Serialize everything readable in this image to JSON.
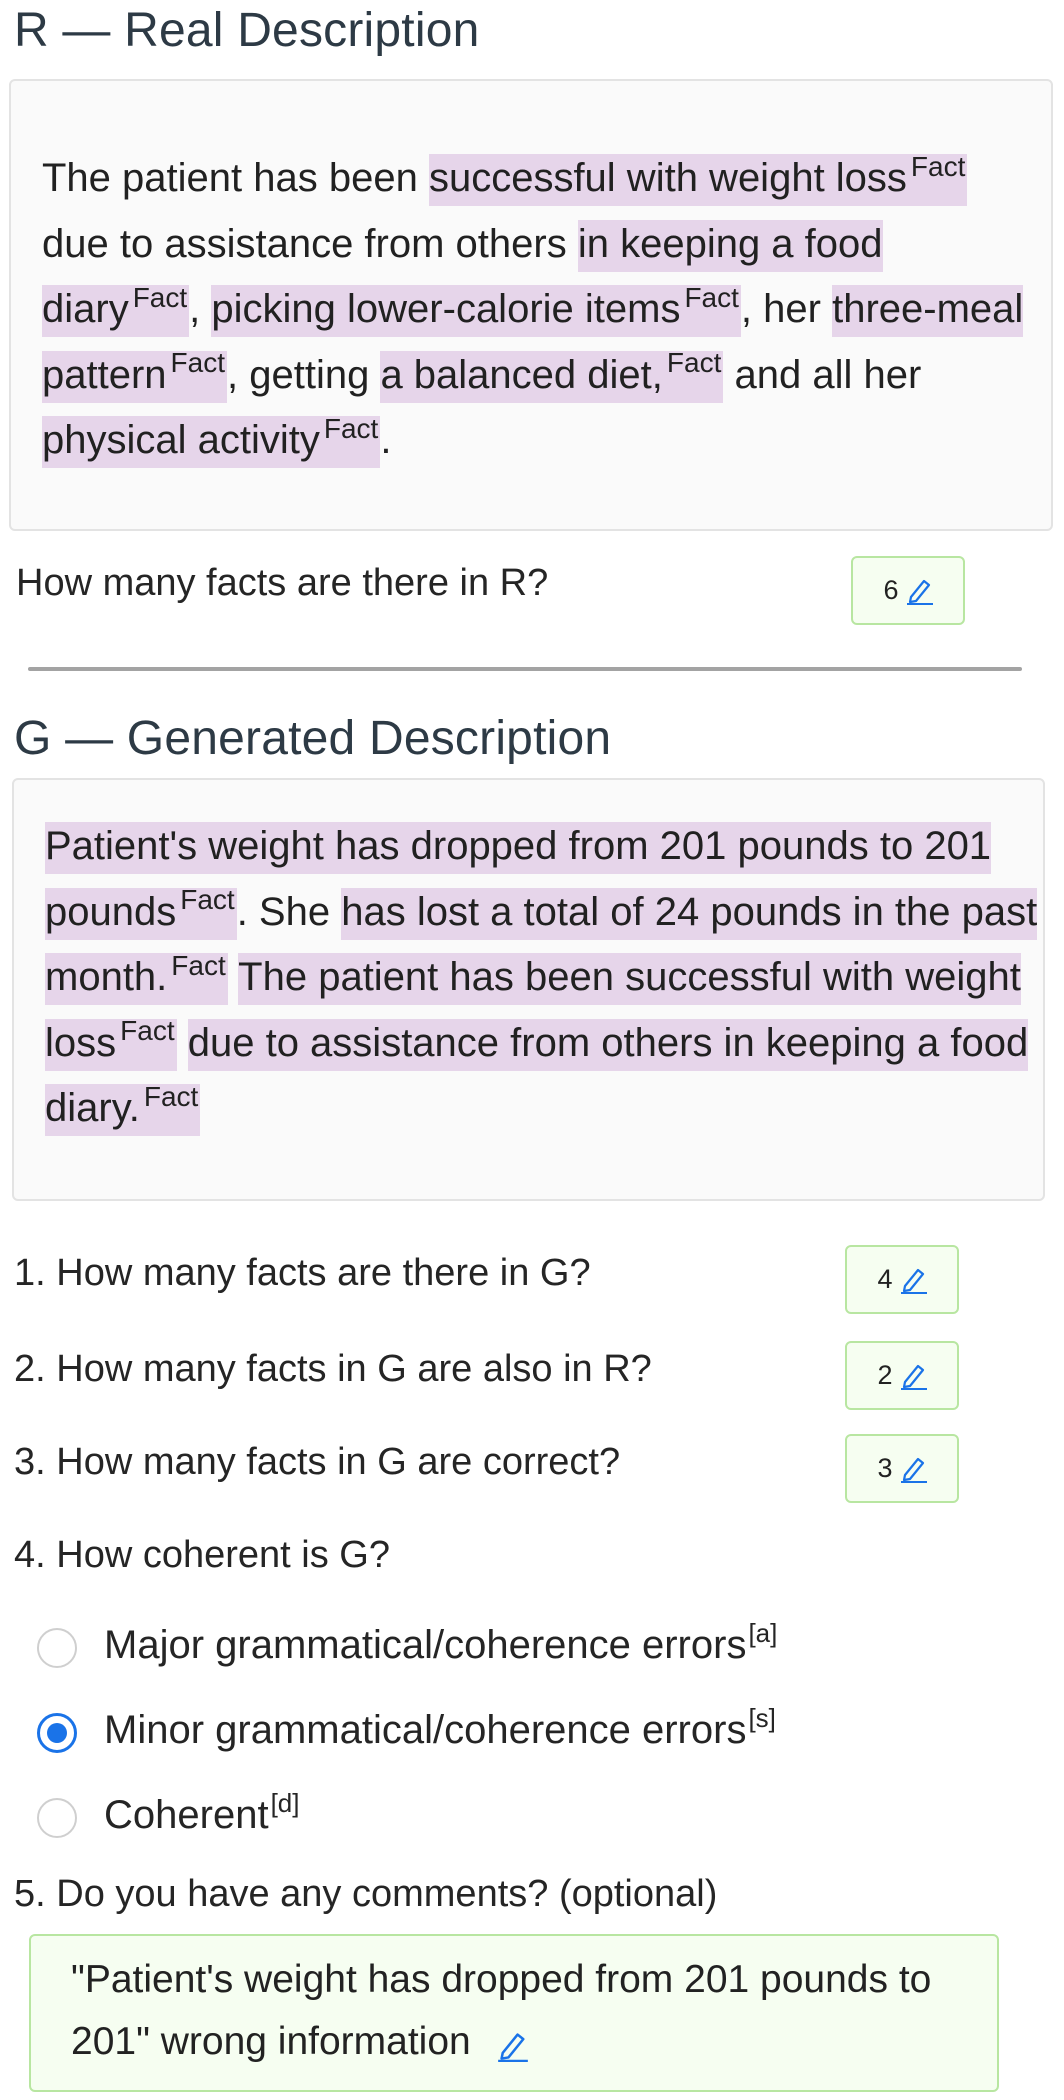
{
  "real_section": {
    "title": "R — Real Description",
    "segments": [
      {
        "t": "The patient has been ",
        "hl": false
      },
      {
        "t": "successful with weight loss",
        "hl": true,
        "tag": "Fact"
      },
      {
        "t": " due to assistance from others ",
        "hl": false
      },
      {
        "t": "in keeping a food diary",
        "hl": true,
        "tag": "Fact"
      },
      {
        "t": ", ",
        "hl": false
      },
      {
        "t": "picking lower-calorie items",
        "hl": true,
        "tag": "Fact"
      },
      {
        "t": ", her ",
        "hl": false
      },
      {
        "t": "three-meal pattern",
        "hl": true,
        "tag": "Fact"
      },
      {
        "t": ", getting ",
        "hl": false
      },
      {
        "t": "a balanced diet,",
        "hl": true,
        "tag": "Fact"
      },
      {
        "t": " and all her ",
        "hl": false
      },
      {
        "t": "physical activity",
        "hl": true,
        "tag": "Fact"
      },
      {
        "t": ".",
        "hl": false
      }
    ],
    "question": "How many facts are there in R?",
    "answer": "6"
  },
  "generated_section": {
    "title": "G — Generated Description",
    "segments": [
      {
        "t": "Patient's weight has dropped from 201 pounds to 201 pounds",
        "hl": true,
        "tag": "Fact"
      },
      {
        "t": ". She ",
        "hl": false
      },
      {
        "t": "has lost a total of 24 pounds in the past month.",
        "hl": true,
        "tag": "Fact"
      },
      {
        "t": " ",
        "hl": false
      },
      {
        "t": "The patient has been successful with weight loss",
        "hl": true,
        "tag": "Fact"
      },
      {
        "t": " ",
        "hl": false
      },
      {
        "t": "due to assistance from others in keeping a food diary.",
        "hl": true,
        "tag": "Fact"
      }
    ]
  },
  "questions": {
    "q1": {
      "label": "1. How many facts are there in G?",
      "answer": "4"
    },
    "q2": {
      "label": "2. How many facts in G are also in R?",
      "answer": "2"
    },
    "q3": {
      "label": "3. How many facts in G are correct?",
      "answer": "3"
    },
    "q4": {
      "label": "4. How coherent is G?",
      "options": [
        {
          "label": "Major grammatical/coherence errors",
          "shortcut": "[a]",
          "selected": false
        },
        {
          "label": "Minor grammatical/coherence errors",
          "shortcut": "[s]",
          "selected": true
        },
        {
          "label": "Coherent",
          "shortcut": "[d]",
          "selected": false
        }
      ]
    },
    "q5": {
      "label": "5. Do you have any comments? (optional)",
      "value": "\"Patient's weight has dropped from 201 pounds to 201\" wrong information"
    }
  },
  "colors": {
    "highlight": "#e6d5ea",
    "accent": "#1a73e8",
    "answer_border": "#b8e6a1"
  },
  "icons": {
    "edit": "pencil-edit-icon"
  }
}
